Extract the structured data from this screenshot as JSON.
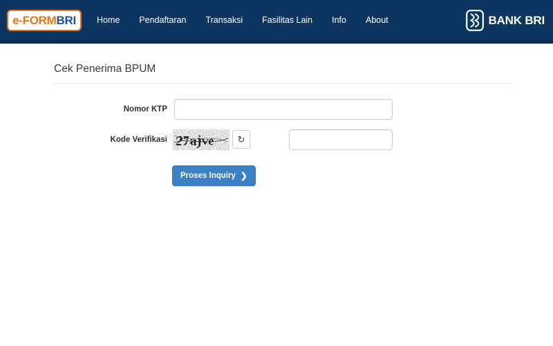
{
  "header": {
    "background_color": "#0c3562",
    "logo": {
      "name": "e-FORM BRI",
      "part_orange": "e-FORM",
      "part_blue": "BRI",
      "orange_color": "#e8731c",
      "blue_color": "#1b4f9c"
    },
    "nav": [
      {
        "label": "Home"
      },
      {
        "label": "Pendaftaran"
      },
      {
        "label": "Transaksi"
      },
      {
        "label": "Fasilitas Lain"
      },
      {
        "label": "Info"
      },
      {
        "label": "About"
      }
    ],
    "bank_logo_text": "BANK BRI"
  },
  "main": {
    "title": "Cek Penerima BPUM",
    "form": {
      "ktp": {
        "label": "Nomor KTP",
        "value": "",
        "placeholder": ""
      },
      "captcha": {
        "label": "Kode Verifikasi",
        "code_text": "27ajve",
        "refresh_icon": "refresh-icon",
        "refresh_glyph": "↻",
        "value": "",
        "placeholder": ""
      },
      "submit": {
        "label": "Proses Inquiry",
        "chevron": "❯",
        "color": "#3b80c4"
      }
    }
  }
}
